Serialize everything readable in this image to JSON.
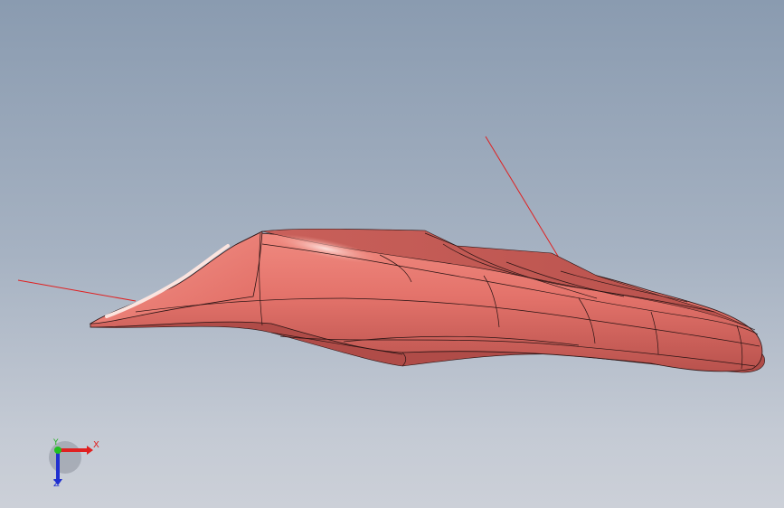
{
  "viewport": {
    "background_top": "#8a9bb0",
    "background_bottom": "#ccd0d8"
  },
  "model": {
    "surface_color": "#e9776f",
    "edge_color": "#2a1414",
    "sketch_line_color": "#e02020"
  },
  "triad": {
    "x_label": "X",
    "y_label": "Y",
    "z_label": "Z",
    "x_color": "#e02020",
    "y_color": "#20b020",
    "z_color": "#2030d0"
  }
}
